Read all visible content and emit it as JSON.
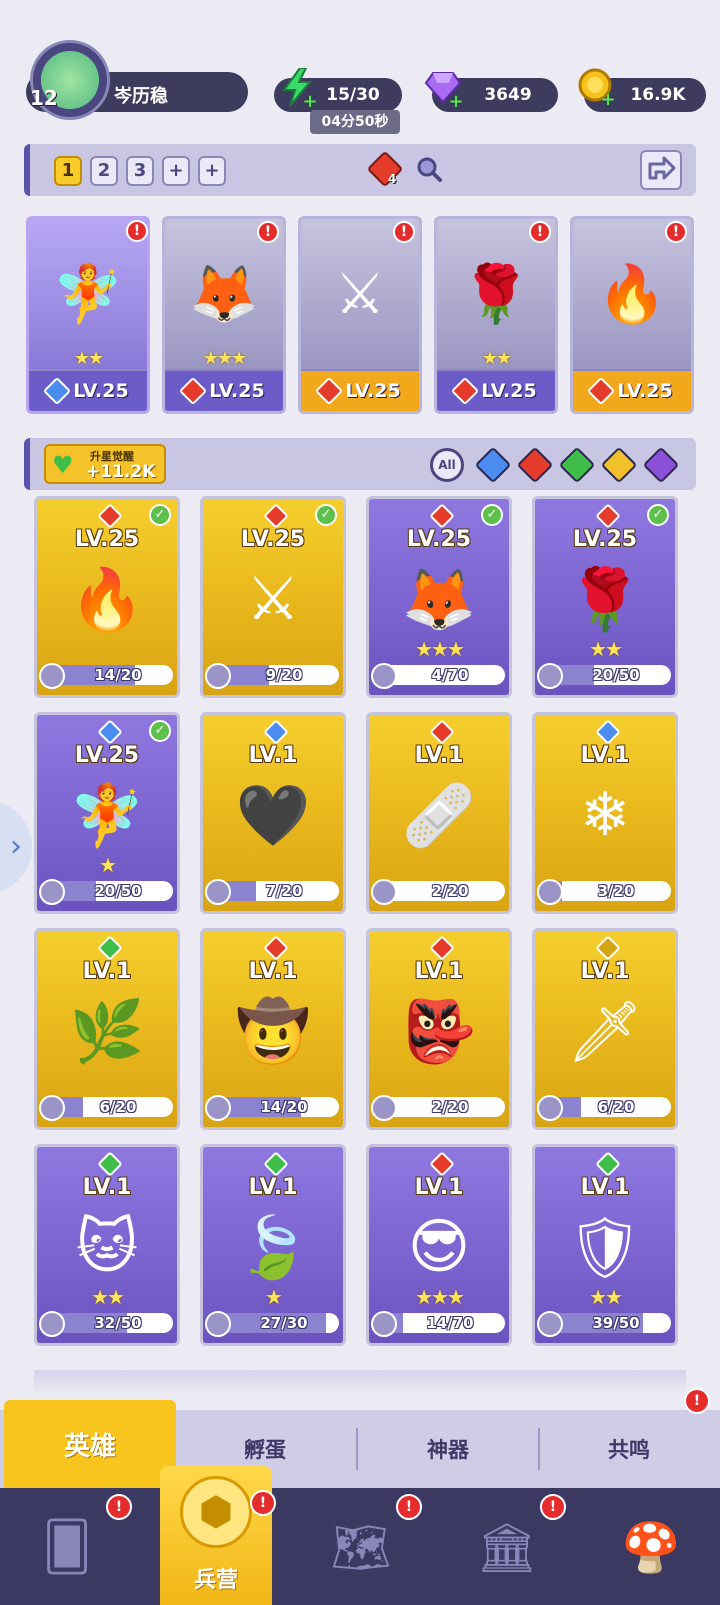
{
  "profile": {
    "level": "12",
    "name": "岑历稳"
  },
  "resources": {
    "energy": "15/30",
    "energy_timer": "04分50秒",
    "gems": "3649",
    "coins": "16.9K"
  },
  "team": {
    "slots": [
      "1",
      "2",
      "3",
      "+",
      "+"
    ],
    "badge_count": "4",
    "members": [
      {
        "level": "LV.25",
        "stars": "★★",
        "element": "water",
        "color": "#4a8cf0"
      },
      {
        "level": "LV.25",
        "stars": "★★★",
        "element": "fire",
        "color": "#e53b2a"
      },
      {
        "level": "LV.25",
        "stars": "",
        "element": "fire",
        "color": "#e53b2a"
      },
      {
        "level": "LV.25",
        "stars": "★★",
        "element": "fire",
        "color": "#e53b2a"
      },
      {
        "level": "LV.25",
        "stars": "",
        "element": "fire",
        "color": "#e53b2a"
      }
    ]
  },
  "awaken": {
    "label": "升星觉醒",
    "value": "+11.2K"
  },
  "filters": {
    "all": "All"
  },
  "heroes": [
    {
      "level": "LV.25",
      "progress": "14/20",
      "ratio": 0.7,
      "check": true,
      "bg": "gold",
      "element": "#e53b2a",
      "stars": ""
    },
    {
      "level": "LV.25",
      "progress": "9/20",
      "ratio": 0.45,
      "check": true,
      "bg": "gold",
      "element": "#e53b2a",
      "stars": ""
    },
    {
      "level": "LV.25",
      "progress": "4/70",
      "ratio": 0.06,
      "check": true,
      "bg": "purple",
      "element": "#e53b2a",
      "stars": "★★★"
    },
    {
      "level": "LV.25",
      "progress": "20/50",
      "ratio": 0.4,
      "check": true,
      "bg": "purple",
      "element": "#e53b2a",
      "stars": "★★"
    },
    {
      "level": "LV.25",
      "progress": "20/50",
      "ratio": 0.4,
      "check": true,
      "bg": "purple",
      "element": "#4a8cf0",
      "stars": "★"
    },
    {
      "level": "LV.1",
      "progress": "7/20",
      "ratio": 0.35,
      "check": false,
      "bg": "gold",
      "element": "#4a8cf0",
      "stars": ""
    },
    {
      "level": "LV.1",
      "progress": "2/20",
      "ratio": 0.1,
      "check": false,
      "bg": "gold",
      "element": "#e53b2a",
      "stars": ""
    },
    {
      "level": "LV.1",
      "progress": "3/20",
      "ratio": 0.15,
      "check": false,
      "bg": "gold",
      "element": "#4a8cf0",
      "stars": ""
    },
    {
      "level": "LV.1",
      "progress": "6/20",
      "ratio": 0.3,
      "check": false,
      "bg": "gold",
      "element": "#3fbf4a",
      "stars": ""
    },
    {
      "level": "LV.1",
      "progress": "14/20",
      "ratio": 0.7,
      "check": false,
      "bg": "gold",
      "element": "#e53b2a",
      "stars": ""
    },
    {
      "level": "LV.1",
      "progress": "2/20",
      "ratio": 0.1,
      "check": false,
      "bg": "gold",
      "element": "#e53b2a",
      "stars": ""
    },
    {
      "level": "LV.1",
      "progress": "6/20",
      "ratio": 0.3,
      "check": false,
      "bg": "gold",
      "element": "#d6a514",
      "stars": ""
    },
    {
      "level": "LV.1",
      "progress": "32/50",
      "ratio": 0.64,
      "check": false,
      "bg": "purple",
      "element": "#3fbf4a",
      "stars": "★★"
    },
    {
      "level": "LV.1",
      "progress": "27/30",
      "ratio": 0.9,
      "check": false,
      "bg": "purple",
      "element": "#3fbf4a",
      "stars": "★"
    },
    {
      "level": "LV.1",
      "progress": "14/70",
      "ratio": 0.2,
      "check": false,
      "bg": "purple",
      "element": "#e53b2a",
      "stars": "★★★"
    },
    {
      "level": "LV.1",
      "progress": "39/50",
      "ratio": 0.78,
      "check": false,
      "bg": "purple",
      "element": "#3fbf4a",
      "stars": "★★"
    }
  ],
  "tabs": {
    "heroes": "英雄",
    "hatch": "孵蛋",
    "artifact": "神器",
    "resonance": "共鸣"
  },
  "nav": {
    "barracks": "兵营"
  }
}
